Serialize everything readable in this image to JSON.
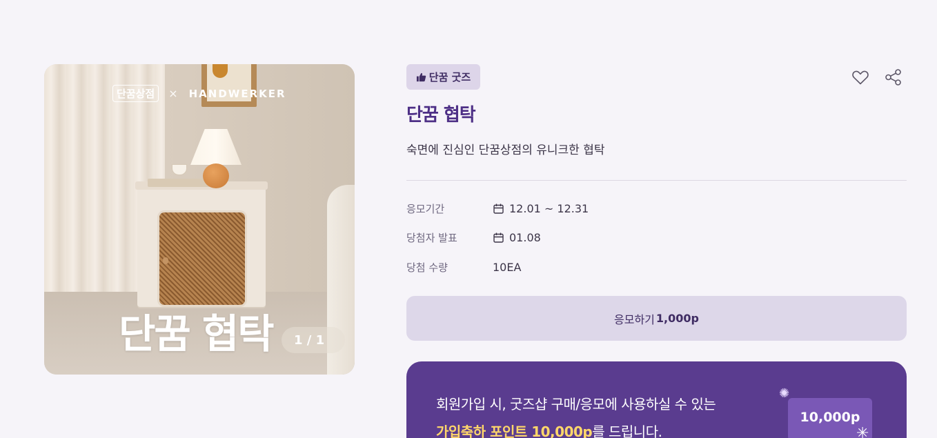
{
  "hero": {
    "brand_left": "단꿈상점",
    "brand_sep": "×",
    "brand_right": "HANDWERKER",
    "overlay_title": "단꿈 협탁",
    "pager": "1 / 1"
  },
  "product": {
    "category": "단꿈 굿즈",
    "category_icon": "thumbs-up-icon",
    "title": "단꿈 협탁",
    "subtitle": "숙면에 진심인 단꿈상점의 유니크한 협탁"
  },
  "info": [
    {
      "label": "응모기간",
      "value": "12.01 ~ 12.31",
      "icon": "calendar-icon"
    },
    {
      "label": "당첨자 발표",
      "value": "01.08",
      "icon": "calendar-icon"
    },
    {
      "label": "당첨 수량",
      "value": "10EA",
      "icon": ""
    }
  ],
  "apply": {
    "label": "응모하기",
    "points": "1,000p"
  },
  "promo": {
    "line1": "회원가입 시, 굿즈샵 구매/응모에 사용하실 수 있는",
    "highlight": "가입축하 포인트 10,000p",
    "line2_suffix": "를 드립니다.",
    "coupon": "10,000p"
  },
  "colors": {
    "accent": "#4d2f86",
    "background": "#f6f4f9",
    "promo_bg": "#5a3c8f",
    "highlight": "#ffd76a"
  }
}
